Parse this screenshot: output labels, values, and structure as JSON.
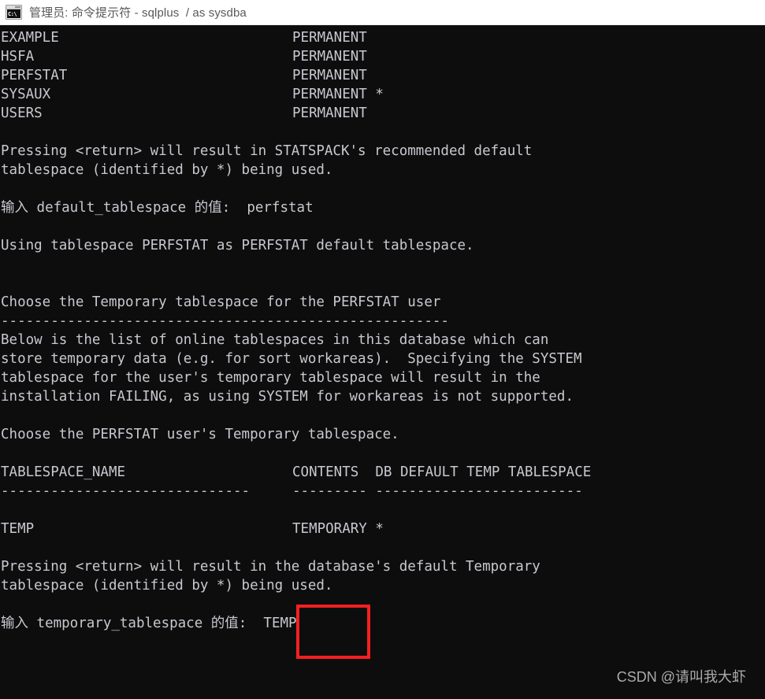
{
  "window": {
    "title": "管理员: 命令提示符 - sqlplus  / as sysdba",
    "icon_name": "cmd-console-icon",
    "icon_glyph": "C:\\",
    "titlebar_bg": "#ffffff",
    "titlebar_fg": "#585858",
    "console_bg": "#0d0d0d",
    "console_fg": "#c8c8d0",
    "highlight_color": "#f42020"
  },
  "console": {
    "tablespace_list": {
      "rows": [
        {
          "name": "EXAMPLE",
          "contents": "PERMANENT"
        },
        {
          "name": "HSFA",
          "contents": "PERMANENT"
        },
        {
          "name": "PERFSTAT",
          "contents": "PERMANENT"
        },
        {
          "name": "SYSAUX",
          "contents": "PERMANENT *"
        },
        {
          "name": "USERS",
          "contents": "PERMANENT"
        }
      ]
    },
    "default_note_line1": "Pressing <return> will result in STATSPACK's recommended default",
    "default_note_line2": "tablespace (identified by *) being used.",
    "default_prompt_label": "输入 default_tablespace 的值:  ",
    "default_prompt_value": "perfstat",
    "using_line": "Using tablespace PERFSTAT as PERFSTAT default tablespace.",
    "choose_heading": "Choose the Temporary tablespace for the PERFSTAT user",
    "choose_heading_rule": "------------------------------------------------------",
    "below_line1": "Below is the list of online tablespaces in this database which can",
    "below_line2": "store temporary data (e.g. for sort workareas).  Specifying the SYSTEM",
    "below_line3": "tablespace for the user's temporary tablespace will result in the",
    "below_line4": "installation FAILING, as using SYSTEM for workareas is not supported.",
    "choose_temp_line": "Choose the PERFSTAT user's Temporary tablespace.",
    "temp_table": {
      "header_col1": "TABLESPACE_NAME",
      "header_col2": "CONTENTS  DB DEFAULT TEMP TABLESPACE",
      "rule_col1": "------------------------------",
      "rule_col2": "--------- -------------------------",
      "rows": [
        {
          "name": "TEMP",
          "contents": "TEMPORARY *"
        }
      ]
    },
    "temp_note_line1": "Pressing <return> will result in the database's default Temporary",
    "temp_note_line2": "tablespace (identified by *) being used.",
    "temp_prompt_label": "输入 temporary_tablespace 的值: ",
    "temp_prompt_value": " TEMP"
  },
  "watermark": {
    "text": "CSDN @请叫我大虾"
  }
}
